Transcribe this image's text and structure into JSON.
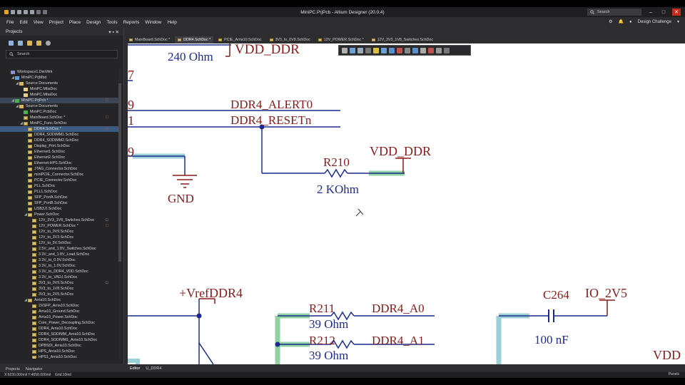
{
  "window": {
    "title": "MiniPC.PrjPcb - Altium Designer (20.0.4)",
    "search_label": "Search"
  },
  "menu": [
    "File",
    "Edit",
    "View",
    "Project",
    "Place",
    "Design",
    "Tools",
    "Reports",
    "Window",
    "Help"
  ],
  "menu_right": {
    "workspace": "Design Challenge"
  },
  "projects_panel": {
    "title": "Projects",
    "search_placeholder": "Search",
    "tabs": [
      "Projects",
      "Navigator"
    ]
  },
  "tree": [
    {
      "label": "Workspace1.DsnWrk",
      "indent": 0,
      "icon": "ws",
      "arrow": ""
    },
    {
      "label": "MiniPC.PrjMbd",
      "indent": 1,
      "icon": "proj",
      "arrow": "◢"
    },
    {
      "label": "Source Documents",
      "indent": 2,
      "icon": "folder",
      "arrow": "◢"
    },
    {
      "label": "MiniPC.MbsDoc",
      "indent": 3,
      "icon": "doc",
      "arrow": ""
    },
    {
      "label": "MiniPC.MbaDoc",
      "indent": 3,
      "icon": "doc",
      "arrow": ""
    },
    {
      "label": "MiniPC.PrjPcb *",
      "indent": 1,
      "icon": "pcb",
      "arrow": "◢",
      "hl": true,
      "mark": "□"
    },
    {
      "label": "Source Documents",
      "indent": 2,
      "icon": "folder",
      "arrow": "◢"
    },
    {
      "label": "MiniPC.PcbDoc",
      "indent": 3,
      "icon": "pcb",
      "arrow": ""
    },
    {
      "label": "MainBoard.SchDoc *",
      "indent": 3,
      "icon": "sch",
      "arrow": "",
      "mark": "□"
    },
    {
      "label": "MiniPC_Func.SchDoc",
      "indent": 3,
      "icon": "sch",
      "arrow": "◢"
    },
    {
      "label": "DDR4.SchDoc *",
      "indent": 4,
      "icon": "sch",
      "arrow": "",
      "selected": true,
      "mark": "□"
    },
    {
      "label": "DDR4_SODIMM1.SchDoc",
      "indent": 4,
      "icon": "sch",
      "arrow": ""
    },
    {
      "label": "DDR4_SODIMM2.SchDoc",
      "indent": 4,
      "icon": "sch",
      "arrow": ""
    },
    {
      "label": "Display_Port.SchDoc",
      "indent": 4,
      "icon": "sch",
      "arrow": ""
    },
    {
      "label": "Ethernet1.SchDoc",
      "indent": 4,
      "icon": "sch",
      "arrow": ""
    },
    {
      "label": "Ethernet2.SchDoc",
      "indent": 4,
      "icon": "sch",
      "arrow": ""
    },
    {
      "label": "Ethernet-HPS.SchDoc",
      "indent": 4,
      "icon": "sch",
      "arrow": ""
    },
    {
      "label": "JTAG_Connector.SchDoc",
      "indent": 4,
      "icon": "sch",
      "arrow": ""
    },
    {
      "label": "miniPCIE_Connector.SchDoc",
      "indent": 4,
      "icon": "sch",
      "arrow": ""
    },
    {
      "label": "PCIE_Connector.SchDoc",
      "indent": 4,
      "icon": "sch",
      "arrow": ""
    },
    {
      "label": "PLL.SchDoc",
      "indent": 4,
      "icon": "sch",
      "arrow": ""
    },
    {
      "label": "PLL1.SchDoc",
      "indent": 4,
      "icon": "sch",
      "arrow": ""
    },
    {
      "label": "SFP_PortA.SchDoc",
      "indent": 4,
      "icon": "sch",
      "arrow": ""
    },
    {
      "label": "SFP_PortB.SchDoc",
      "indent": 4,
      "icon": "sch",
      "arrow": ""
    },
    {
      "label": "USB3.0.SchDoc",
      "indent": 4,
      "icon": "sch",
      "arrow": ""
    },
    {
      "label": "Power.SchDoc",
      "indent": 4,
      "icon": "sch",
      "arrow": "◢"
    },
    {
      "label": "12V_3V3_1V8_Switches.SchDoc",
      "indent": 5,
      "icon": "sch",
      "arrow": "",
      "mark": "□",
      "mark_grey": true
    },
    {
      "label": "12V_POWER.SchDoc *",
      "indent": 5,
      "icon": "sch",
      "arrow": "",
      "mark": "□"
    },
    {
      "label": "12V_to_0V9.SchDoc",
      "indent": 5,
      "icon": "sch",
      "arrow": ""
    },
    {
      "label": "12V_to_3V3.SchDoc",
      "indent": 5,
      "icon": "sch",
      "arrow": ""
    },
    {
      "label": "12V_to_5V.SchDoc",
      "indent": 5,
      "icon": "sch",
      "arrow": ""
    },
    {
      "label": "2.5V_and_1.8V_Switches.SchDoc",
      "indent": 5,
      "icon": "sch",
      "arrow": ""
    },
    {
      "label": "3.3V_and_1.8V_Load.SchDoc",
      "indent": 5,
      "icon": "sch",
      "arrow": ""
    },
    {
      "label": "3.3V_to_0.9V.SchDoc",
      "indent": 5,
      "icon": "sch",
      "arrow": ""
    },
    {
      "label": "3.3V_to_1.0V.SchDoc",
      "indent": 5,
      "icon": "sch",
      "arrow": ""
    },
    {
      "label": "3.3V_to_DDR4_VDD.SchDoc",
      "indent": 5,
      "icon": "sch",
      "arrow": ""
    },
    {
      "label": "3.3V_to_VADJ.SchDoc",
      "indent": 5,
      "icon": "sch",
      "arrow": ""
    },
    {
      "label": "3V3_to_0V9.SchDoc",
      "indent": 5,
      "icon": "sch",
      "arrow": "",
      "mark": "□",
      "mark_grey": true
    },
    {
      "label": "3V3_to_1V8.SchDoc",
      "indent": 5,
      "icon": "sch",
      "arrow": ""
    },
    {
      "label": "3V3_to_2V5.SchDoc",
      "indent": 5,
      "icon": "sch",
      "arrow": ""
    },
    {
      "label": "Arria10.SchDoc",
      "indent": 4,
      "icon": "sch",
      "arrow": "◢"
    },
    {
      "label": "2XSFP_Arria10.SchDoc",
      "indent": 5,
      "icon": "sch",
      "arrow": ""
    },
    {
      "label": "Arria10_Ground.SchDoc",
      "indent": 5,
      "icon": "sch",
      "arrow": ""
    },
    {
      "label": "Arria10_Power.SchDoc",
      "indent": 5,
      "icon": "sch",
      "arrow": ""
    },
    {
      "label": "Core_Power_Decoupling.SchDoc",
      "indent": 5,
      "icon": "sch",
      "arrow": ""
    },
    {
      "label": "DDR4_Arria10.SchDoc",
      "indent": 5,
      "icon": "sch",
      "arrow": ""
    },
    {
      "label": "DDR4_SODIMM_Arria10.SchDoc",
      "indent": 5,
      "icon": "sch",
      "arrow": ""
    },
    {
      "label": "DDR4_SODIMM1_Arria10.SchDoc",
      "indent": 5,
      "icon": "sch",
      "arrow": ""
    },
    {
      "label": "DPBSDI_Arria10.SchDoc",
      "indent": 5,
      "icon": "sch",
      "arrow": ""
    },
    {
      "label": "HPS_Arria10.SchDoc",
      "indent": 5,
      "icon": "sch",
      "arrow": ""
    },
    {
      "label": "HPS1_Arria10.SchDoc",
      "indent": 5,
      "icon": "sch",
      "arrow": ""
    }
  ],
  "doc_tabs": [
    {
      "label": "MainBoard.SchDoc *",
      "active": false
    },
    {
      "label": "DDR4.SchDoc *",
      "active": true
    },
    {
      "label": "PCIE_Arria10.SchDoc",
      "active": false
    },
    {
      "label": "3V3_to_0V9.SchDoc",
      "active": false
    },
    {
      "label": "12V_POWER.SchDoc *",
      "active": false
    },
    {
      "label": "12V_3V3_1V8_Switches.SchDoc",
      "active": false
    }
  ],
  "schematic": {
    "labels": {
      "r_top_value": "240 Ohm",
      "vdd_top": "VDD_DDR",
      "pin7": "7",
      "pin9a": "9",
      "pin1": "1",
      "alert": "DDR4_ALERT0",
      "reset": "DDR4_RESETn",
      "pin9b": "9",
      "r210": "R210",
      "r210_val": "2 KOhm",
      "vdd_mid": "VDD_DDR",
      "gnd": "GND",
      "vref": "+VrefDDR4",
      "r211": "R211",
      "r211_val": "39 Ohm",
      "r212": "R212",
      "r212_val": "39 Ohm",
      "a0": "DDR4_A0",
      "a1": "DDR4_A1",
      "c264": "C264",
      "c264_val": "100 nF",
      "io": "IO_2V5",
      "vdd_right": "VDD"
    }
  },
  "bottom_tabs": [
    "Editor",
    "U_DDR4"
  ],
  "status": {
    "coords": "X:6230.000mil Y:4650.000mil",
    "grid": "Grid:10mil",
    "panels": "Panels"
  }
}
